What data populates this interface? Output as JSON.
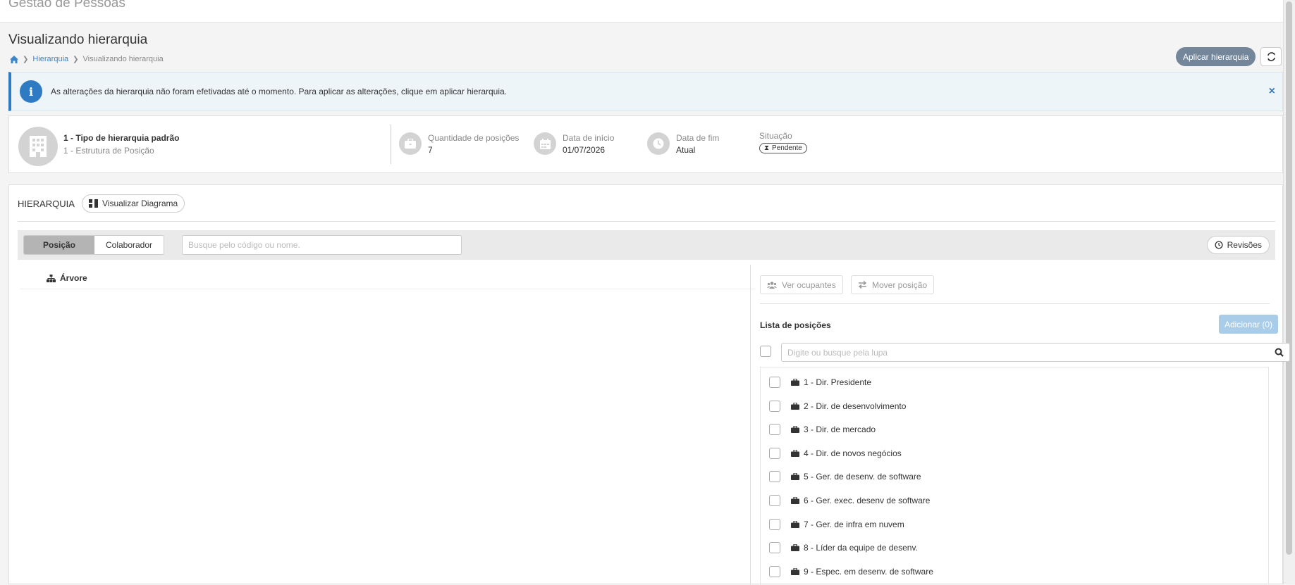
{
  "app": {
    "title": "Gestão de Pessoas"
  },
  "page": {
    "title": "Visualizando hierarquia",
    "breadcrumb": {
      "link": "Hierarquia",
      "current": "Visualizando hierarquia"
    }
  },
  "actions": {
    "apply_label": "Aplicar hierarquia"
  },
  "alert": {
    "message": "As alterações da hierarquia não foram efetivadas até o momento. Para aplicar as alterações, clique em aplicar hierarquia.",
    "close": "×"
  },
  "summary": {
    "name": "1 - Tipo de hierarquia padrão",
    "sub": "1 - Estrutura de Posição",
    "qty_label": "Quantidade de posições",
    "qty_value": "7",
    "start_label": "Data de início",
    "start_value": "01/07/2026",
    "end_label": "Data de fim",
    "end_value": "Atual",
    "status_label": "Situação",
    "status_value": "Pendente"
  },
  "hierarchy": {
    "title": "HIERARQUIA",
    "diagram_button": "Visualizar Diagrama",
    "tabs": {
      "position": "Posição",
      "collaborator": "Colaborador"
    },
    "search_placeholder": "Busque pelo código ou nome.",
    "revisions_button": "Revisões",
    "tree_label": "Árvore"
  },
  "positions_panel": {
    "view_occupants": "Ver ocupantes",
    "move_position": "Mover posição",
    "list_title": "Lista de posições",
    "add_button": "Adicionar (0)",
    "search_placeholder": "Digite ou busque pela lupa",
    "items": [
      "1 - Dir. Presidente",
      "2 - Dir. de desenvolvimento",
      "3 - Dir. de mercado",
      "4 - Dir. de novos negócios",
      "5 - Ger. de desenv. de software",
      "6 - Ger. exec. desenv de software",
      "7 - Ger. de infra em nuvem",
      "8 - Líder da equipe de desenv.",
      "9 - Espec. em desenv. de software"
    ]
  },
  "colors": {
    "accent": "#2e7bc4",
    "apply_button": "#74879a",
    "add_button": "#a9cde8"
  }
}
